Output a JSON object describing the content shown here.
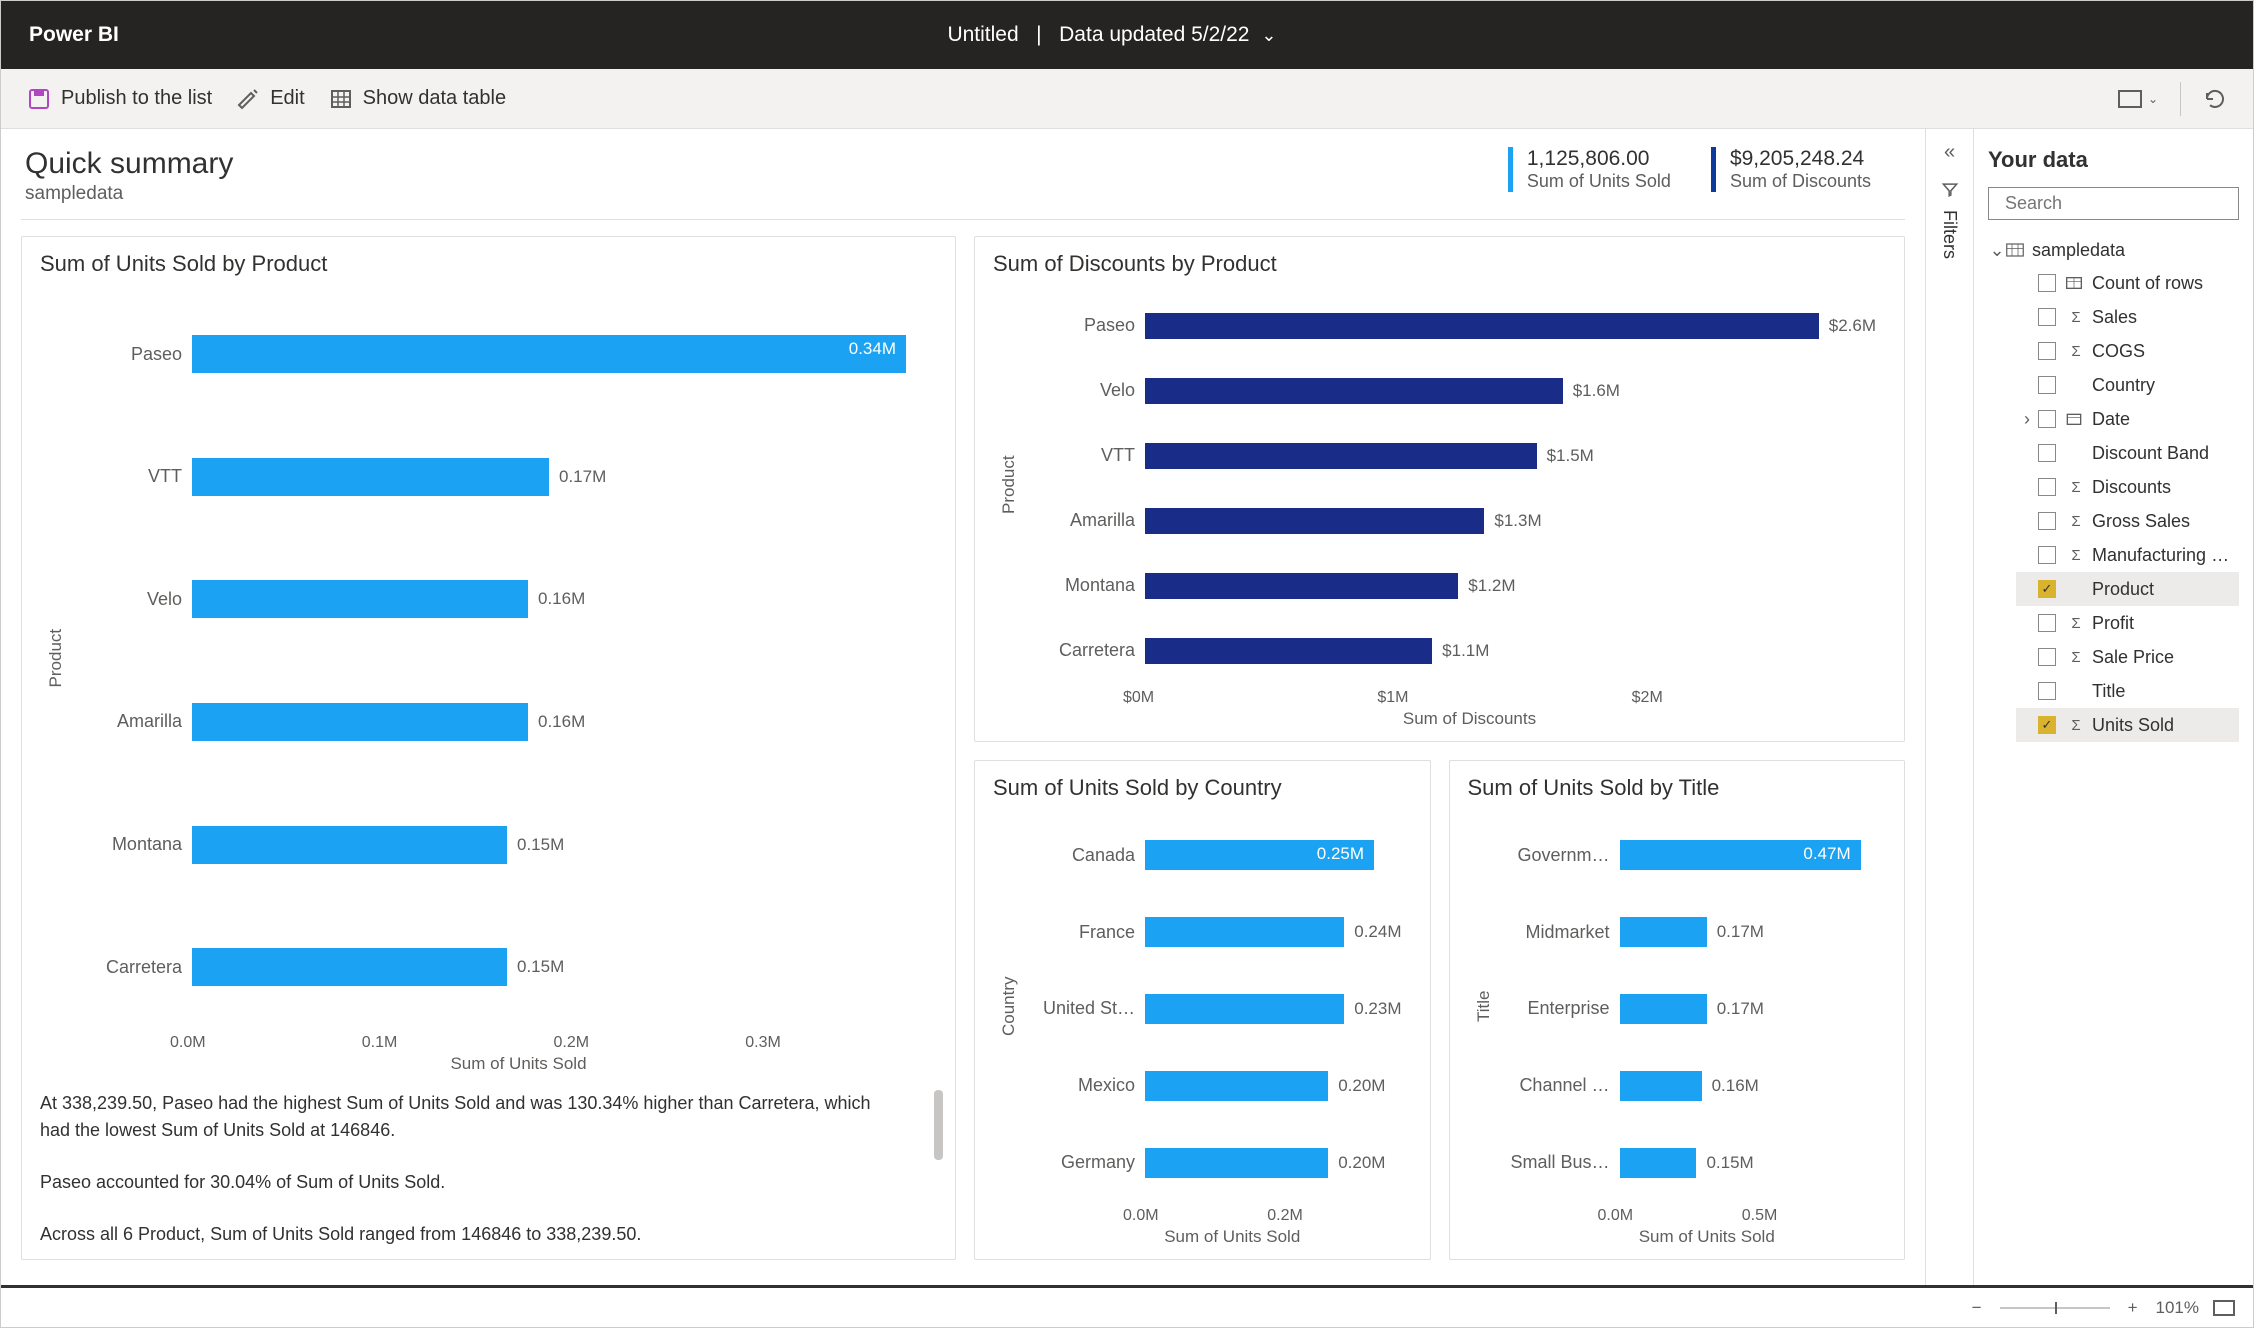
{
  "titlebar": {
    "app": "Power BI",
    "doc": "Untitled",
    "updated": "Data updated 5/2/22"
  },
  "toolbar": {
    "publish": "Publish to the list",
    "edit": "Edit",
    "show_table": "Show data table"
  },
  "summary": {
    "title": "Quick summary",
    "source": "sampledata",
    "kpi1_value": "1,125,806.00",
    "kpi1_label": "Sum of Units Sold",
    "kpi2_value": "$9,205,248.24",
    "kpi2_label": "Sum of Discounts"
  },
  "chart1": {
    "title": "Sum of Units Sold by Product",
    "ylabel": "Product",
    "xtitle": "Sum of Units Sold",
    "ticks": [
      "0.0M",
      "0.1M",
      "0.2M",
      "0.3M"
    ],
    "insight1": "At 338,239.50, Paseo had the highest Sum of Units Sold and was 130.34% higher than Carretera, which had the lowest Sum of Units Sold at 146846.",
    "insight2": "Paseo accounted for 30.04% of Sum of Units Sold.",
    "insight3": "Across all 6 Product, Sum of Units Sold ranged from 146846 to 338,239.50."
  },
  "chart2": {
    "title": "Sum of Discounts by Product",
    "ylabel": "Product",
    "xtitle": "Sum of Discounts",
    "ticks": [
      "$0M",
      "$1M",
      "$2M"
    ]
  },
  "chart3": {
    "title": "Sum of Units Sold by Country",
    "ylabel": "Country",
    "xtitle": "Sum of Units Sold",
    "ticks": [
      "0.0M",
      "0.2M"
    ]
  },
  "chart4": {
    "title": "Sum of Units Sold by Title",
    "ylabel": "Title",
    "xtitle": "Sum of Units Sold",
    "ticks": [
      "0.0M",
      "0.5M"
    ]
  },
  "datapanel": {
    "title": "Your data",
    "search_placeholder": "Search",
    "root": "sampledata",
    "fields": [
      {
        "label": "Count of rows",
        "type": "table",
        "checked": false
      },
      {
        "label": "Sales",
        "type": "sigma",
        "checked": false
      },
      {
        "label": "COGS",
        "type": "sigma",
        "checked": false
      },
      {
        "label": "Country",
        "type": "",
        "checked": false
      },
      {
        "label": "Date",
        "type": "cal",
        "checked": false,
        "expandable": true
      },
      {
        "label": "Discount Band",
        "type": "",
        "checked": false
      },
      {
        "label": "Discounts",
        "type": "sigma",
        "checked": false
      },
      {
        "label": "Gross Sales",
        "type": "sigma",
        "checked": false
      },
      {
        "label": "Manufacturing …",
        "type": "sigma",
        "checked": false
      },
      {
        "label": "Product",
        "type": "",
        "checked": true
      },
      {
        "label": "Profit",
        "type": "sigma",
        "checked": false
      },
      {
        "label": "Sale Price",
        "type": "sigma",
        "checked": false
      },
      {
        "label": "Title",
        "type": "",
        "checked": false
      },
      {
        "label": "Units Sold",
        "type": "sigma",
        "checked": true
      }
    ]
  },
  "filters": {
    "label": "Filters"
  },
  "status": {
    "zoom": "101%"
  },
  "chart_data": [
    {
      "id": "chart1",
      "type": "bar",
      "orientation": "horizontal",
      "title": "Sum of Units Sold by Product",
      "ylabel": "Product",
      "xlabel": "Sum of Units Sold",
      "categories": [
        "Paseo",
        "VTT",
        "Velo",
        "Amarilla",
        "Montana",
        "Carretera"
      ],
      "values": [
        0.34,
        0.17,
        0.16,
        0.16,
        0.15,
        0.15
      ],
      "display": [
        "0.34M",
        "0.17M",
        "0.16M",
        "0.16M",
        "0.15M",
        "0.15M"
      ],
      "xlim": [
        0,
        0.35
      ],
      "color": "#1ba2f2"
    },
    {
      "id": "chart2",
      "type": "bar",
      "orientation": "horizontal",
      "title": "Sum of Discounts by Product",
      "ylabel": "Product",
      "xlabel": "Sum of Discounts",
      "categories": [
        "Paseo",
        "Velo",
        "VTT",
        "Amarilla",
        "Montana",
        "Carretera"
      ],
      "values": [
        2.6,
        1.6,
        1.5,
        1.3,
        1.2,
        1.1
      ],
      "display": [
        "$2.6M",
        "$1.6M",
        "$1.5M",
        "$1.3M",
        "$1.2M",
        "$1.1M"
      ],
      "xlim": [
        0,
        2.8
      ],
      "color": "#192c87"
    },
    {
      "id": "chart3",
      "type": "bar",
      "orientation": "horizontal",
      "title": "Sum of Units Sold by Country",
      "ylabel": "Country",
      "xlabel": "Sum of Units Sold",
      "categories": [
        "Canada",
        "France",
        "United St…",
        "Mexico",
        "Germany"
      ],
      "values": [
        0.25,
        0.24,
        0.23,
        0.2,
        0.2
      ],
      "display": [
        "0.25M",
        "0.24M",
        "0.23M",
        "0.20M",
        "0.20M"
      ],
      "xlim": [
        0,
        0.28
      ],
      "color": "#1ba2f2"
    },
    {
      "id": "chart4",
      "type": "bar",
      "orientation": "horizontal",
      "title": "Sum of Units Sold by Title",
      "ylabel": "Title",
      "xlabel": "Sum of Units Sold",
      "categories": [
        "Governm…",
        "Midmarket",
        "Enterprise",
        "Channel …",
        "Small Bus…"
      ],
      "values": [
        0.47,
        0.17,
        0.17,
        0.16,
        0.15
      ],
      "display": [
        "0.47M",
        "0.17M",
        "0.17M",
        "0.16M",
        "0.15M"
      ],
      "xlim": [
        0,
        0.5
      ],
      "color": "#1ba2f2"
    }
  ]
}
